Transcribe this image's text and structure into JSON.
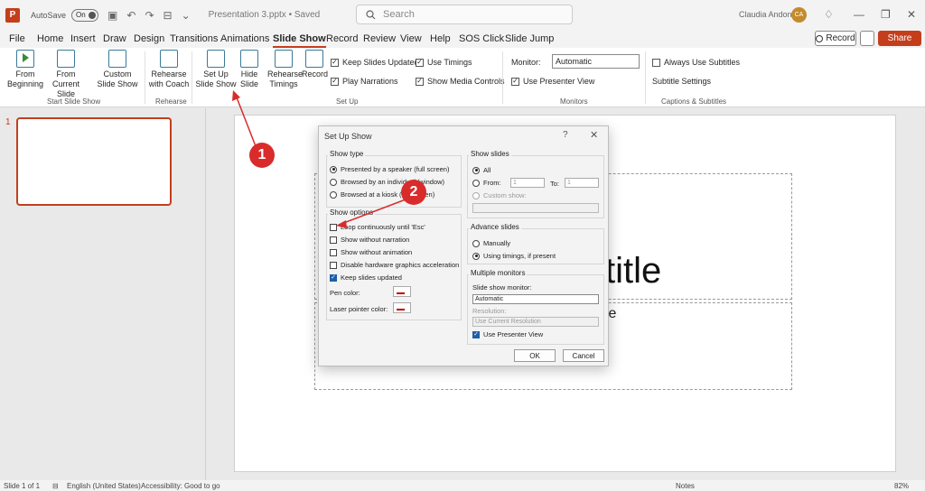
{
  "titlebar": {
    "autosave_label": "AutoSave",
    "autosave_state": "On",
    "document_title": "Presentation 3.pptx • Saved",
    "search_placeholder": "Search",
    "user_name": "Claudia Andone",
    "user_initials": "CA"
  },
  "menu": {
    "tabs": [
      "File",
      "Home",
      "Insert",
      "Draw",
      "Design",
      "Transitions",
      "Animations",
      "Slide Show",
      "Record",
      "Review",
      "View",
      "Help",
      "SOS Click",
      "Slide Jump"
    ],
    "active_tab": "Slide Show",
    "record_label": "Record",
    "share_label": "Share"
  },
  "ribbon": {
    "from_beginning": "From Beginning",
    "from_current": "From Current Slide",
    "custom_show": "Custom Slide Show",
    "rehearse_coach": "Rehearse with Coach",
    "setup_show": "Set Up Slide Show",
    "hide_slide": "Hide Slide",
    "rehearse_timings": "Rehearse Timings",
    "record": "Record",
    "keep_updated": "Keep Slides Updated",
    "use_timings": "Use Timings",
    "play_narrations": "Play Narrations",
    "show_media": "Show Media Controls",
    "monitor_label": "Monitor:",
    "monitor_value": "Automatic",
    "presenter_view": "Use Presenter View",
    "always_subtitles": "Always Use Subtitles",
    "subtitle_settings": "Subtitle Settings",
    "groups": {
      "start": "Start Slide Show",
      "rehearse": "Rehearse",
      "setup": "Set Up",
      "monitors": "Monitors",
      "captions": "Captions & Subtitles"
    }
  },
  "slides_panel": {
    "slide_number": "1"
  },
  "canvas": {
    "title_fragment": "l title",
    "subtitle_fragment": "le"
  },
  "dialog": {
    "title": "Set Up Show",
    "help": "?",
    "close": "✕",
    "show_type": {
      "title": "Show type",
      "options": [
        "Presented by a speaker (full screen)",
        "Browsed by an individual (window)",
        "Browsed at a kiosk (full screen)"
      ],
      "selected": 0
    },
    "show_options": {
      "title": "Show options",
      "loop": "Loop continuously until 'Esc'",
      "no_narration": "Show without narration",
      "no_animation": "Show without animation",
      "disable_hw": "Disable hardware graphics acceleration",
      "keep_updated": "Keep slides updated",
      "pen_color": "Pen color:",
      "laser_color": "Laser pointer color:"
    },
    "show_slides": {
      "title": "Show slides",
      "all": "All",
      "from": "From:",
      "from_value": "1",
      "to": "To:",
      "to_value": "1",
      "custom": "Custom show:"
    },
    "advance": {
      "title": "Advance slides",
      "manually": "Manually",
      "timings": "Using timings, if present"
    },
    "monitors": {
      "title": "Multiple monitors",
      "monitor_label": "Slide show monitor:",
      "monitor_value": "Automatic",
      "resolution_label": "Resolution:",
      "resolution_value": "Use Current Resolution",
      "presenter_view": "Use Presenter View"
    },
    "ok": "OK",
    "cancel": "Cancel"
  },
  "annotations": {
    "badge1": "1",
    "badge2": "2",
    "color": "#d92b2b"
  },
  "statusbar": {
    "slide_info": "Slide 1 of 1",
    "language": "English (United States)",
    "accessibility": "Accessibility: Good to go",
    "notes": "Notes",
    "zoom": "82%"
  }
}
